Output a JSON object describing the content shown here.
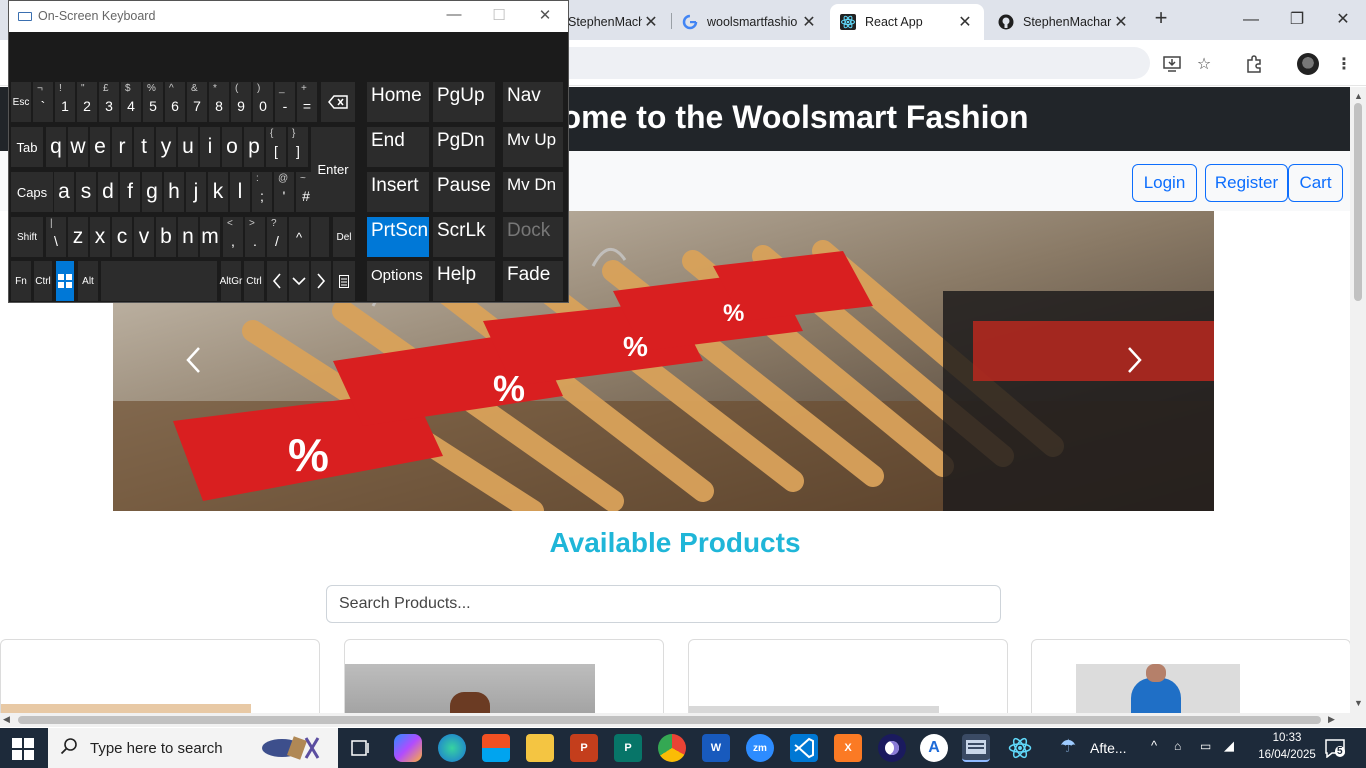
{
  "browser": {
    "tabs": [
      {
        "title": "StephenMachar",
        "favicon": "github-icon",
        "active": false
      },
      {
        "title": "woolsmartfashio",
        "favicon": "google-icon",
        "active": false
      },
      {
        "title": "React App",
        "favicon": "react-icon",
        "active": true
      },
      {
        "title": "StephenMachar",
        "favicon": "github-icon",
        "active": false
      }
    ],
    "new_tab": "+",
    "close_glyph": "✕"
  },
  "site": {
    "title": "Welcome to the Woolsmart Fashion",
    "nav": {
      "login": "Login",
      "register": "Register",
      "cart": "Cart"
    },
    "section_title": "Available Products",
    "search_placeholder": "Search Products..."
  },
  "osk": {
    "title": "On-Screen Keyboard",
    "rows": {
      "r1": [
        [
          "Esc",
          ""
        ],
        [
          "`",
          "¬"
        ],
        [
          "1",
          "!"
        ],
        [
          "2",
          "\""
        ],
        [
          "3",
          "£"
        ],
        [
          "4",
          "$"
        ],
        [
          "5",
          "%"
        ],
        [
          "6",
          "^"
        ],
        [
          "7",
          "&"
        ],
        [
          "8",
          "*"
        ],
        [
          "9",
          "("
        ],
        [
          "0",
          ")"
        ],
        [
          "-",
          "_"
        ],
        [
          "=",
          "+"
        ]
      ],
      "r2": [
        "q",
        "w",
        "e",
        "r",
        "t",
        "y",
        "u",
        "i",
        "o",
        "p"
      ],
      "r2b": [
        [
          "[",
          "{"
        ],
        [
          "]",
          "}"
        ]
      ],
      "r3": [
        "a",
        "s",
        "d",
        "f",
        "g",
        "h",
        "j",
        "k",
        "l"
      ],
      "r3b": [
        [
          ";",
          ":"
        ],
        [
          "'",
          "@"
        ],
        [
          "#",
          "~"
        ]
      ],
      "r4": [
        "z",
        "x",
        "c",
        "v",
        "b",
        "n",
        "m"
      ],
      "r4b": [
        [
          ",",
          "<"
        ],
        [
          ".",
          ">"
        ],
        [
          "/",
          "?"
        ]
      ]
    },
    "keys": {
      "tab": "Tab",
      "enter": "Enter",
      "caps": "Caps",
      "shift": "Shift",
      "fn": "Fn",
      "ctrl": "Ctrl",
      "alt": "Alt",
      "altgr": "AltGr",
      "del": "Del",
      "backslash": "\\",
      "pipe": "|",
      "up": "^",
      "home": "Home",
      "pgup": "PgUp",
      "nav": "Nav",
      "end": "End",
      "pgdn": "PgDn",
      "mvup": "Mv Up",
      "insert": "Insert",
      "pause": "Pause",
      "mvdn": "Mv Dn",
      "prtscn": "PrtScn",
      "scrlk": "ScrLk",
      "dock": "Dock",
      "options": "Options",
      "help": "Help",
      "fade": "Fade"
    }
  },
  "taskbar": {
    "search_placeholder": "Type here to search",
    "weather": "Afte...",
    "time": "10:33",
    "date": "16/04/2025",
    "notifications": "5"
  }
}
